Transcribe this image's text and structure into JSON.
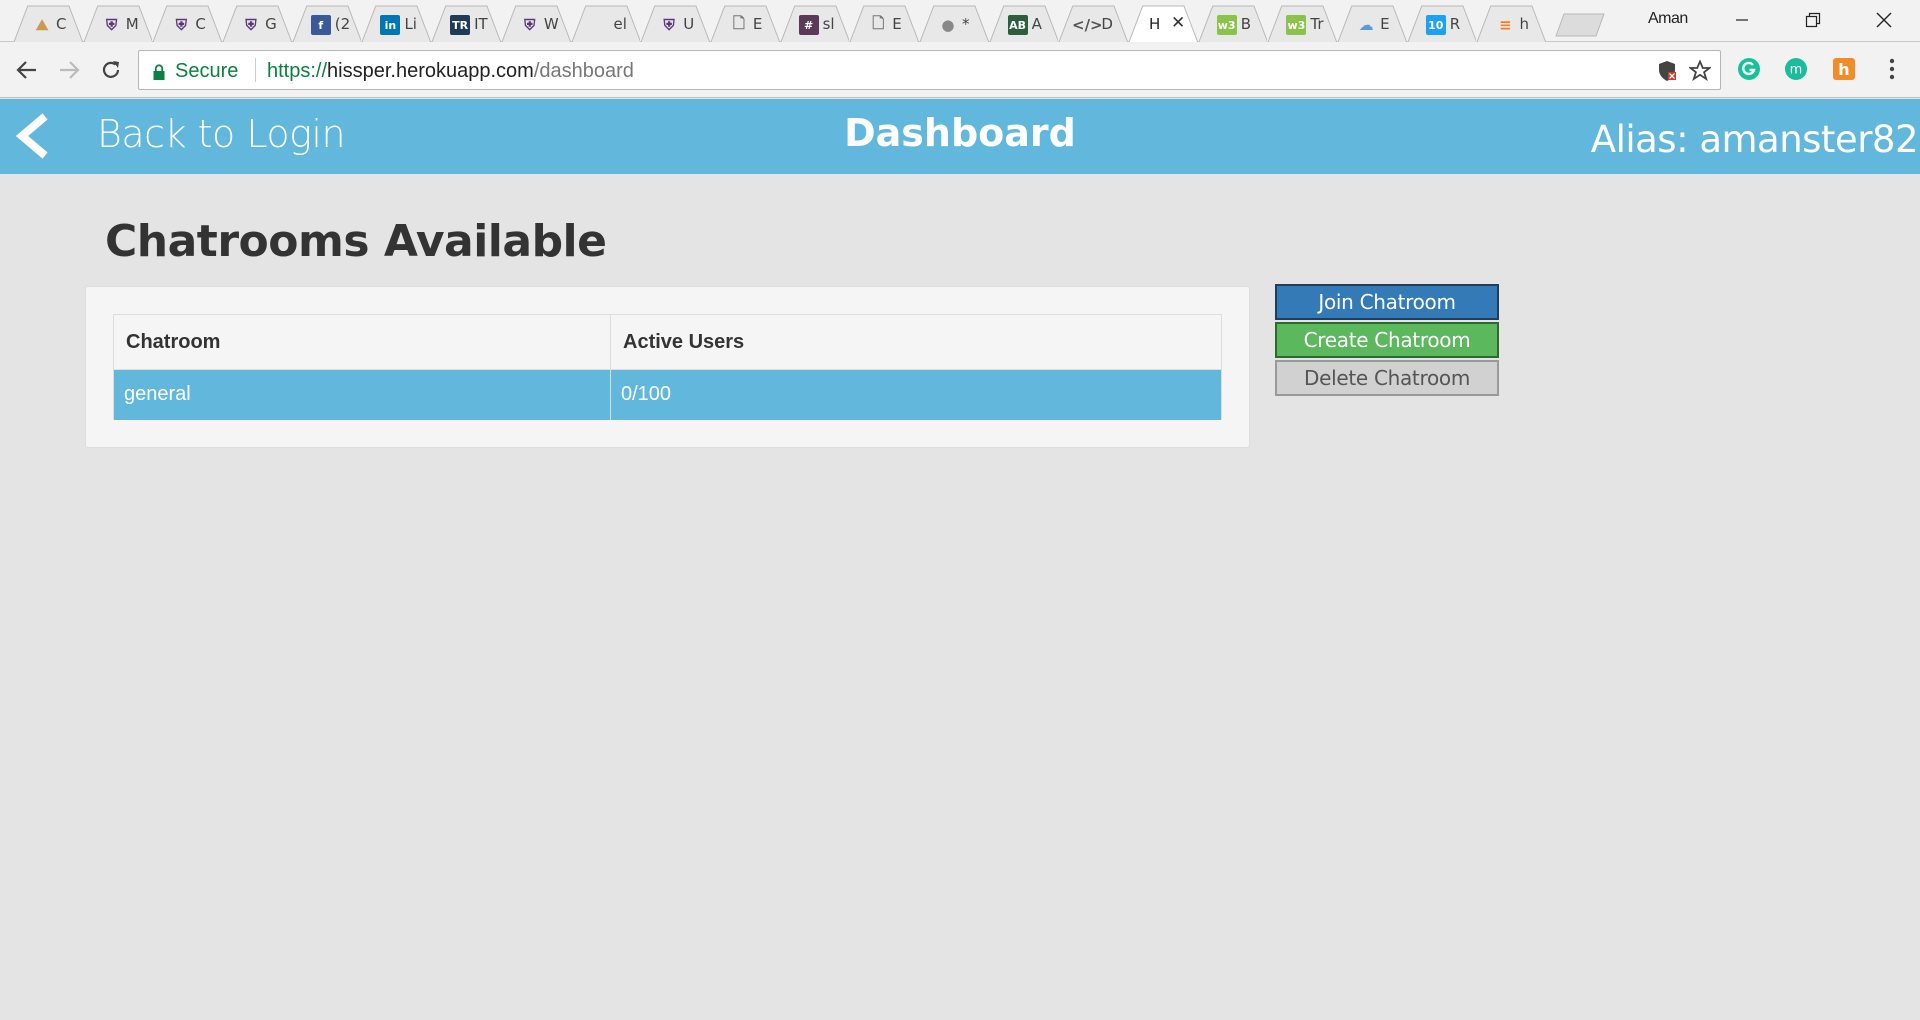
{
  "browser": {
    "tabs": [
      {
        "label": "C",
        "icon": "hiker-icon",
        "color": "#c89a54"
      },
      {
        "label": "M",
        "icon": "crest-icon",
        "color": "#5a3a78"
      },
      {
        "label": "C",
        "icon": "crest-icon",
        "color": "#5a3a78"
      },
      {
        "label": "G",
        "icon": "crest-icon",
        "color": "#5a3a78"
      },
      {
        "label": "(2",
        "icon": "facebook-icon",
        "color": "#3b5998"
      },
      {
        "label": "Li",
        "icon": "linkedin-icon",
        "color": "#0077b5"
      },
      {
        "label": "IT",
        "icon": "tr-icon",
        "color": "#1f3b5a"
      },
      {
        "label": "W",
        "icon": "crest-icon",
        "color": "#5a3a78"
      },
      {
        "label": "el",
        "icon": "blank-icon",
        "color": "#ffffff"
      },
      {
        "label": "U",
        "icon": "crest-icon",
        "color": "#5a3a78"
      },
      {
        "label": "E",
        "icon": "document-icon",
        "color": "#777777"
      },
      {
        "label": "sl",
        "icon": "hash-icon",
        "color": "#5a3a5a"
      },
      {
        "label": "E",
        "icon": "document-icon",
        "color": "#777777"
      },
      {
        "label": "*",
        "icon": "record-icon",
        "color": "#888888"
      },
      {
        "label": "A",
        "icon": "ab-icon",
        "color": "#2e5e3e"
      },
      {
        "label": "D",
        "icon": "code-icon",
        "color": "#555555"
      },
      {
        "label": "H",
        "icon": "none",
        "color": "#ffffff",
        "active": true
      },
      {
        "label": "B",
        "icon": "w3-icon",
        "color": "#8bc34a"
      },
      {
        "label": "Tr",
        "icon": "w3-icon",
        "color": "#8bc34a"
      },
      {
        "label": "E",
        "icon": "cloud-icon",
        "color": "#5b9bd5"
      },
      {
        "label": "R",
        "icon": "ten-icon",
        "color": "#1da1f2"
      },
      {
        "label": "h",
        "icon": "stack-icon",
        "color": "#f48024"
      }
    ],
    "profile_name": "Aman",
    "secure_label": "Secure",
    "url": {
      "scheme": "https://",
      "host": "hissper.herokuapp.com",
      "path": "/dashboard"
    }
  },
  "header": {
    "back_label": "Back to Login",
    "title": "Dashboard",
    "alias": "Alias: amanster82"
  },
  "main": {
    "section_title": "Chatrooms Available",
    "table": {
      "columns": [
        "Chatroom",
        "Active Users"
      ],
      "rows": [
        {
          "chatroom": "general",
          "active_users": "0/100"
        }
      ]
    },
    "buttons": {
      "join": "Join Chatroom",
      "create": "Create Chatroom",
      "delete": "Delete Chatroom"
    }
  },
  "colors": {
    "header_bg": "#62b8dc",
    "selected_row": "#62b8dc",
    "join": "#337ab7",
    "create": "#5cb85c",
    "delete": "#d1d1d1",
    "page_bg": "#e4e4e4"
  }
}
